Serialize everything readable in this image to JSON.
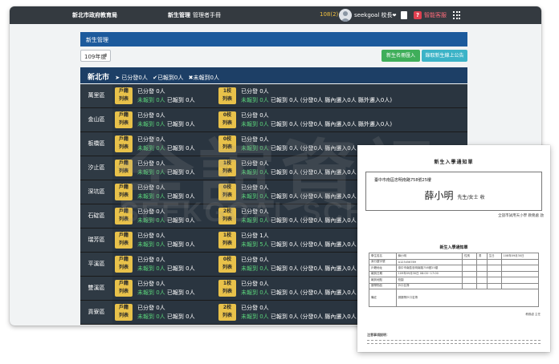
{
  "topbar": {
    "site_title": "新北市政府教育局",
    "module_name": "新生管理",
    "manual_label": "管理者手冊",
    "notification_count": "108(2)",
    "user_label": "seekgoal 校長",
    "help_label": "智能客服",
    "help_icon_char": "?",
    "caret_char": "❤"
  },
  "panel": {
    "header": "新生管理",
    "year_select": "109年度",
    "import_button": "新生名冊匯入",
    "notice_button": "錄取新生線上公告"
  },
  "district_bar": {
    "city": "新北市",
    "stats": [
      {
        "icon": "➤",
        "text": "已分發0人"
      },
      {
        "icon": "✔",
        "text": "已報到0人"
      },
      {
        "icon": "✖",
        "text": "未報到0人"
      }
    ]
  },
  "badge_bottom": "列表",
  "rows": [
    {
      "name": "萬里區",
      "b1": "戶籍",
      "l1": "已分發 0人",
      "l2a": "未報到 0人",
      "l2b": "已報到 0人",
      "b2": "1校",
      "r1": "已分發 0人",
      "r2a": "未報到 0人",
      "r2b": "已報到 0人 (分發0人 縣內遷入0人 縣外遷入0人)"
    },
    {
      "name": "金山區",
      "b1": "戶籍",
      "l1": "已分發 0人",
      "l2a": "未報到 0人",
      "l2b": "已報到 0人",
      "b2": "0校",
      "r1": "已分發 0人",
      "r2a": "未報到 0人",
      "r2b": "已報到 0人 (分發0人 縣內遷入0人 縣外遷入0人)"
    },
    {
      "name": "板橋區",
      "b1": "戶籍",
      "l1": "已分發 0人",
      "l2a": "未報到 0人",
      "l2b": "已報到 0人",
      "b2": "0校",
      "r1": "已分發 0人",
      "r2a": "未報到 0人",
      "r2b": "已報到 0人 (分發0人 縣內遷入0人 縣外遷入0人)"
    },
    {
      "name": "汐止區",
      "b1": "戶籍",
      "l1": "已分發 0人",
      "l2a": "未報到 0人",
      "l2b": "已報到 0人",
      "b2": "1校",
      "r1": "已分發 0人",
      "r2a": "未報到 0人",
      "r2b": "已報到 0人 (分發0人 縣內遷入0人 縣外遷入0人)"
    },
    {
      "name": "深坑區",
      "b1": "戶籍",
      "l1": "已分發 0人",
      "l2a": "未報到 0人",
      "l2b": "已報到 0人",
      "b2": "0校",
      "r1": "已分發 0人",
      "r2a": "未報到 0人",
      "r2b": "已報到 0人 (分發0人 縣內遷入0人 縣外遷入0人)"
    },
    {
      "name": "石碇區",
      "b1": "戶籍",
      "l1": "已分發 0人",
      "l2a": "未報到 0人",
      "l2b": "已報到 0人",
      "b2": "2校",
      "r1": "已分發 0人",
      "r2a": "未報到 0人",
      "r2b": "已報到 0人 (分發0人 縣內遷入0人 縣外遷入0人)"
    },
    {
      "name": "瑞芳區",
      "b1": "戶籍",
      "l1": "已分發 0人",
      "l2a": "未報到 0人",
      "l2b": "已報到 0人",
      "b2": "1校",
      "r1": "已分發 1人",
      "r2a": "未報到 5人",
      "r2b": "已報到 0人 (分發0人 縣內遷入0人 縣外遷入0人)"
    },
    {
      "name": "平溪區",
      "b1": "戶籍",
      "l1": "已分發 0人",
      "l2a": "未報到 0人",
      "l2b": "已報到 0人",
      "b2": "0校",
      "r1": "已分發 0人",
      "r2a": "未報到 0人",
      "r2b": "已報到 0人 (分發0人 縣內遷入0人 縣外遷入0人)"
    },
    {
      "name": "雙溪區",
      "b1": "戶籍",
      "l1": "已分發 0人",
      "l2a": "未報到 0人",
      "l2b": "已報到 0人",
      "b2": "1校",
      "r1": "已分發 0人",
      "r2a": "未報到 0人",
      "r2b": "已報到 0人 (分發0人 縣內遷入0人 縣外遷入0人)"
    },
    {
      "name": "貢寮區",
      "b1": "戶籍",
      "l1": "已分發 0人",
      "l2a": "未報到 0人",
      "l2b": "已報到 0人",
      "b2": "2校",
      "r1": "已分發 0人",
      "r2a": "未報到 0人",
      "r2b": "已報到 0人 (分發0人 縣內遷入0人 縣外遷入0人)"
    }
  ],
  "paper": {
    "title": "新生入學通知單",
    "address": "臺中市南區忠明南路758號25樓",
    "recipient_name": "薛小明",
    "recipient_suffix": "先生/女士 收",
    "school_line": "全誼市試用天小學 教務處 啟",
    "inner_title": "新生入學通知單",
    "table_rows": [
      [
        "學生姓名",
        "薛小明",
        "性別",
        "男",
        "生日",
        "108年09月30日"
      ],
      [
        "身分證字號",
        "A123456789",
        "",
        "",
        "",
        ""
      ],
      [
        "戶籍地址",
        "臺中市南區忠明南路758號25樓",
        "",
        "",
        "",
        ""
      ],
      [
        "報到日期",
        "109年09月30日 08:00~17:00",
        "",
        "",
        "",
        ""
      ],
      [
        "報到地點",
        "校園",
        "",
        "",
        "",
        ""
      ],
      [
        "攜帶物品",
        "戶口名簿",
        "",
        "",
        "",
        ""
      ]
    ],
    "note_label": "備註",
    "note_text": "請攜帶戶口名簿",
    "footer": "教務處 主任",
    "notes_heading": "注意事項說明："
  },
  "watermark": {
    "big": "全誼資訊",
    "small": "SEEKGOAL SCHOOLSOFT"
  }
}
